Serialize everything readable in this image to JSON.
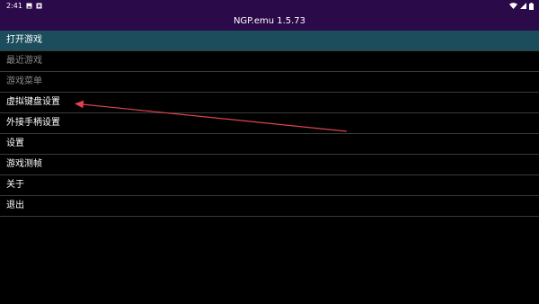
{
  "status_bar": {
    "time": "2:41",
    "left_icons": [
      "image-icon",
      "close-box-icon"
    ],
    "right_icons": [
      "wifi-icon",
      "signal-icon",
      "battery-icon"
    ]
  },
  "app": {
    "title": "NGP.emu 1.5.73"
  },
  "menu": {
    "items": [
      {
        "label": "打开游戏",
        "state": "selected"
      },
      {
        "label": "最近游戏",
        "state": "disabled"
      },
      {
        "label": "游戏菜单",
        "state": "disabled"
      },
      {
        "label": "虚拟键盘设置",
        "state": "normal"
      },
      {
        "label": "外接手柄设置",
        "state": "normal"
      },
      {
        "label": "设置",
        "state": "normal"
      },
      {
        "label": "游戏测帧",
        "state": "normal"
      },
      {
        "label": "关于",
        "state": "normal"
      },
      {
        "label": "退出",
        "state": "normal"
      }
    ]
  },
  "annotation": {
    "type": "arrow",
    "color": "#e0444d",
    "points_to": "虚拟键盘设置"
  },
  "colors": {
    "header_bg": "#2b0a4a",
    "selected_bg": "#1b4d5c",
    "divider": "#3a3a3a",
    "background": "#000000"
  }
}
